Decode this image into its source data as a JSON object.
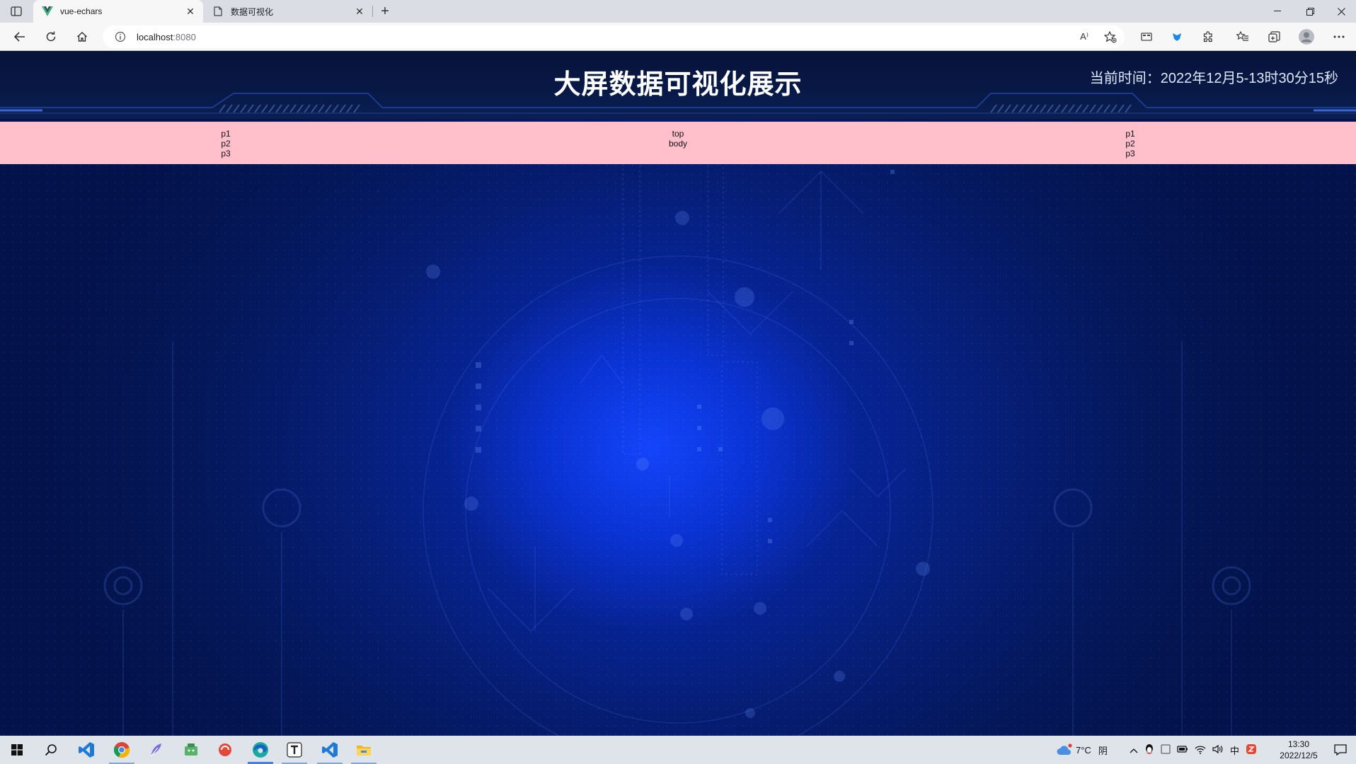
{
  "browser": {
    "tabs": [
      {
        "title": "vue-echars",
        "active": true,
        "favicon": "vue-logo-icon"
      },
      {
        "title": "数据可视化",
        "active": false,
        "favicon": "document-icon"
      }
    ],
    "url_host": "localhost",
    "url_port": ":8080",
    "read_aloud_label": "A⁾"
  },
  "page": {
    "title": "大屏数据可视化展示",
    "time": "当前时间：2022年12月5-13时30分15秒",
    "left_items": [
      "p1",
      "p2",
      "p3"
    ],
    "middle_items": [
      "top",
      "body"
    ],
    "right_items": [
      "p1",
      "p2",
      "p3"
    ],
    "pink_bar_color": "#ffc0cb",
    "background_color": "#0a2aa8"
  },
  "taskbar": {
    "weather_temp": "7°C",
    "weather_desc": "阴",
    "ime_label": "中",
    "time": "13:30",
    "date": "2022/12/5"
  }
}
